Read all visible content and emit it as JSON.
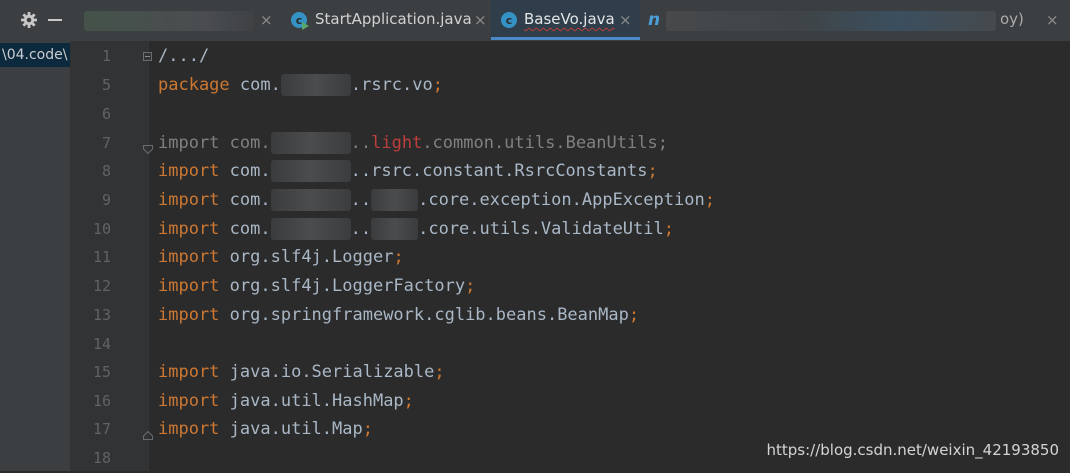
{
  "project_panel": {
    "path_text": "\\04.code\\"
  },
  "tabs": [
    {
      "label": "",
      "state": "obscured"
    },
    {
      "label": "StartApplication.java",
      "icon": "java-class-run-icon"
    },
    {
      "label": "BaseVo.java",
      "icon": "java-class-icon",
      "active": true
    },
    {
      "label": "oy)",
      "icon": "n-file-icon",
      "state": "partially-obscured"
    }
  ],
  "close_glyph": "×",
  "editor": {
    "line_numbers": [
      "1",
      "5",
      "6",
      "7",
      "8",
      "9",
      "10",
      "11",
      "12",
      "13",
      "14",
      "15",
      "16",
      "17",
      "18"
    ],
    "folded_header": "/.../",
    "package_kw": "package",
    "package_prefix": "com.",
    "package_suffix": ".rsrc.vo",
    "import_kw": "import",
    "imports": [
      {
        "a": "com.",
        "b": "..",
        "c": "light",
        "d": ".common.utils.BeanUtils",
        "unused": true
      },
      {
        "a": "com.",
        "b": "..rsrc.constant.RsrcConstants"
      },
      {
        "a": "com.",
        "b": "..",
        "c": ".core.exception.AppException"
      },
      {
        "a": "com.",
        "b": "..",
        "c": ".core.utils.ValidateUtil"
      },
      {
        "text": "org.slf4j.Logger"
      },
      {
        "text": "org.slf4j.LoggerFactory"
      },
      {
        "text": "org.springframework.cglib.beans.BeanMap"
      },
      {
        "text": "java.io.Serializable"
      },
      {
        "text": "java.util.HashMap"
      },
      {
        "text": "java.util.Map"
      }
    ],
    "semicolon": ";"
  },
  "watermark": "https://blog.csdn.net/weixin_42193850",
  "colors": {
    "background": "#2b2b2b",
    "keyword": "#cc7832",
    "identifier": "#a9b7c6",
    "unused_import": "#808080",
    "error_red": "#bc3f3c",
    "gutter_number": "#606366",
    "active_tab_underline": "#4a88c7"
  }
}
